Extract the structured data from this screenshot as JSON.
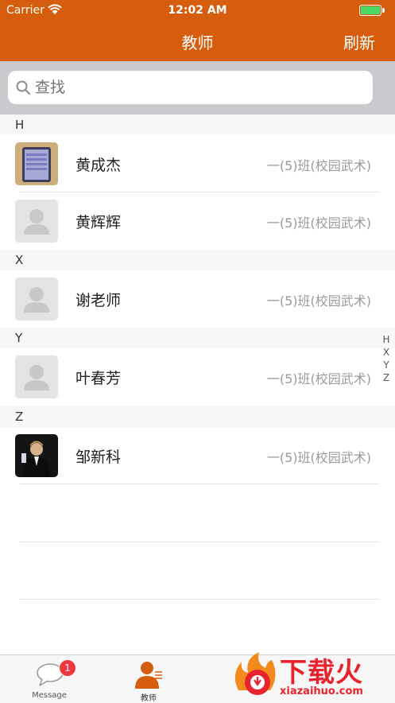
{
  "status": {
    "carrier": "Carrier",
    "time": "12:02 AM"
  },
  "nav": {
    "title": "教师",
    "refresh_label": "刷新"
  },
  "search": {
    "placeholder": "查找"
  },
  "sections": [
    {
      "letter": "H",
      "teachers": [
        {
          "name": "黄成杰",
          "class": "一(5)班(校园武术)",
          "avatar": "photo-phone"
        },
        {
          "name": "黄辉辉",
          "class": "一(5)班(校园武术)",
          "avatar": "default-person"
        }
      ]
    },
    {
      "letter": "X",
      "teachers": [
        {
          "name": "谢老师",
          "class": "一(5)班(校园武术)",
          "avatar": "default-person"
        }
      ]
    },
    {
      "letter": "Y",
      "teachers": [
        {
          "name": "叶春芳",
          "class": "一(5)班(校园武术)",
          "avatar": "default-person"
        }
      ]
    },
    {
      "letter": "Z",
      "teachers": [
        {
          "name": "邹新科",
          "class": "一(5)班(校园武术)",
          "avatar": "photo-man"
        }
      ]
    }
  ],
  "index_letters": [
    "H",
    "X",
    "Y",
    "Z"
  ],
  "tabs": [
    {
      "label": "Message",
      "icon": "chat-bubble-icon",
      "badge": "1",
      "active": false
    },
    {
      "label": "教师",
      "icon": "teacher-icon",
      "active": true
    }
  ],
  "watermark": {
    "text": "下载火",
    "url": "xiazaihuo.com"
  },
  "colors": {
    "accent": "#d55d0d",
    "badge": "#f0353c",
    "watermark": "#e8232d"
  }
}
